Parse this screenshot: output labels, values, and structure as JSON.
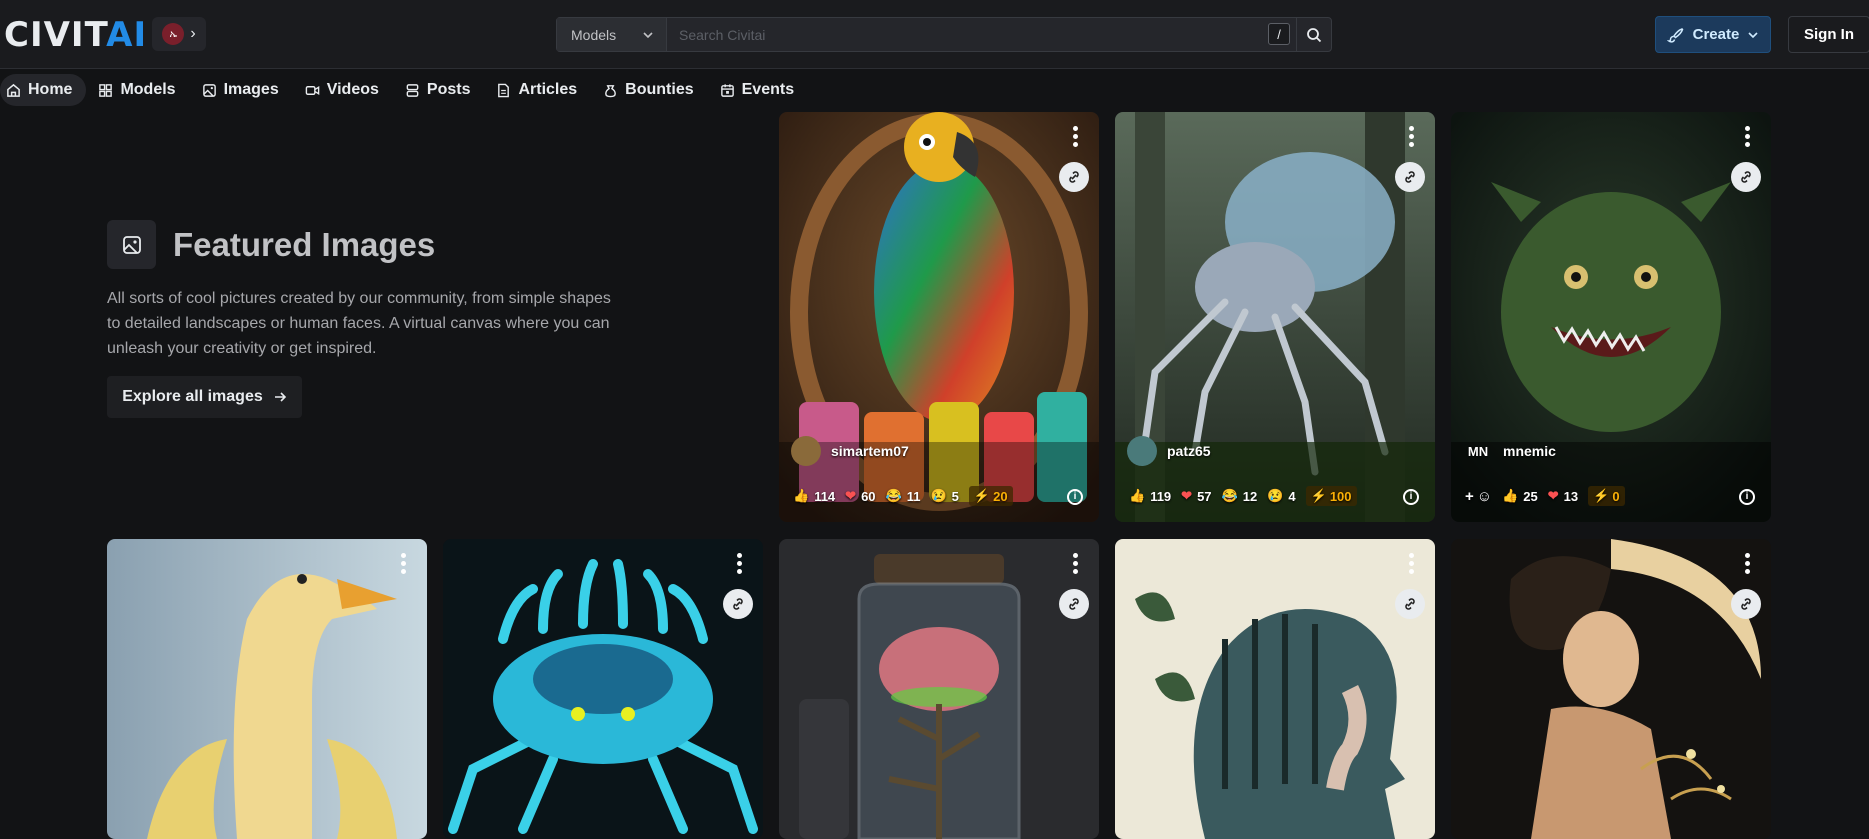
{
  "brand": {
    "logo_main": "CIVIT",
    "logo_accent": "AI",
    "avatar_initial": "ኤ"
  },
  "search": {
    "category": "Models",
    "placeholder": "Search Civitai",
    "shortcut": "/"
  },
  "header": {
    "create_label": "Create",
    "signin_label": "Sign In"
  },
  "nav": [
    {
      "label": "Home",
      "icon": "home-icon"
    },
    {
      "label": "Models",
      "icon": "models-icon"
    },
    {
      "label": "Images",
      "icon": "images-icon"
    },
    {
      "label": "Videos",
      "icon": "videos-icon"
    },
    {
      "label": "Posts",
      "icon": "posts-icon"
    },
    {
      "label": "Articles",
      "icon": "articles-icon"
    },
    {
      "label": "Bounties",
      "icon": "bounties-icon"
    },
    {
      "label": "Events",
      "icon": "events-icon"
    }
  ],
  "featured": {
    "title": "Featured Images",
    "description": "All sorts of cool pictures created by our community, from simple shapes to detailed landscapes or human faces. A virtual canvas where you can unleash your creativity or get inspired.",
    "button_label": "Explore all images"
  },
  "cards": [
    {
      "user": "simartem07",
      "likes": "114",
      "hearts": "60",
      "laughs": "11",
      "cries": "5",
      "buzz": "20"
    },
    {
      "user": "patz65",
      "likes": "119",
      "hearts": "57",
      "laughs": "12",
      "cries": "4",
      "buzz": "100"
    },
    {
      "user": "mnemic",
      "avatar": "MN",
      "likes": "25",
      "hearts": "13",
      "buzz": "0"
    }
  ],
  "colors": {
    "accent": "#228be6",
    "background": "#121315",
    "buzz": "#fab005",
    "heart": "#fa5252"
  }
}
